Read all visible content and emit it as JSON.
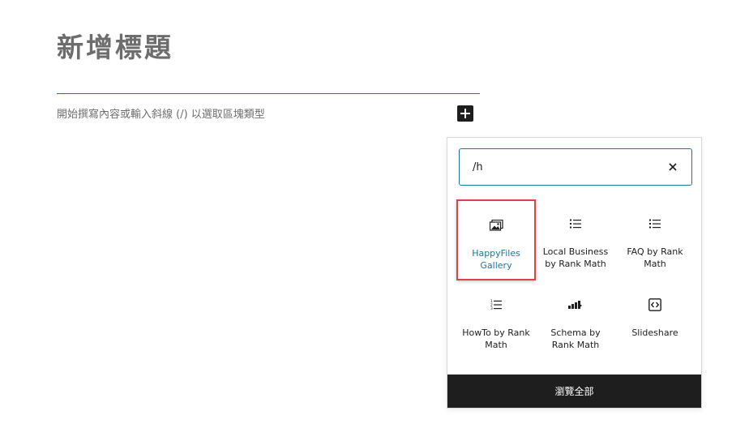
{
  "editor": {
    "title_placeholder": "新增標題",
    "content_placeholder": "開始撰寫內容或輸入斜線 (/) 以選取區塊類型"
  },
  "inserter": {
    "search_value": "/h",
    "blocks": [
      {
        "label": "HappyFiles Gallery",
        "icon": "gallery-icon",
        "highlighted": true
      },
      {
        "label": "Local Business by Rank Math",
        "icon": "list-icon"
      },
      {
        "label": "FAQ by Rank Math",
        "icon": "list-icon"
      },
      {
        "label": "HowTo by Rank Math",
        "icon": "ordered-list-icon"
      },
      {
        "label": "Schema by Rank Math",
        "icon": "schema-icon"
      },
      {
        "label": "Slideshare",
        "icon": "embed-icon"
      }
    ],
    "browse_all_label": "瀏覽全部"
  },
  "colors": {
    "accent": "#1e73a0",
    "highlight_border": "#d9434a",
    "dark": "#1e1e1e"
  }
}
